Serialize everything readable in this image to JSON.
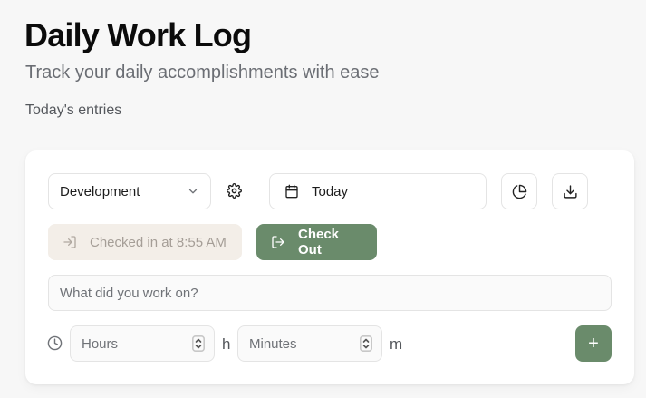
{
  "header": {
    "title": "Daily Work Log",
    "subtitle": "Track your daily accomplishments with ease",
    "section_label": "Today's entries"
  },
  "controls": {
    "category_value": "Development",
    "date_value": "Today"
  },
  "checkin": {
    "status_text": "Checked in at 8:55 AM",
    "checkout_label": "Check Out"
  },
  "entry": {
    "work_placeholder": "What did you work on?",
    "hours_placeholder": "Hours",
    "hours_unit": "h",
    "minutes_placeholder": "Minutes",
    "minutes_unit": "m",
    "add_label": "+"
  },
  "colors": {
    "accent": "#6a8b6b",
    "checked_in_bg": "#f3eee8"
  },
  "icons": {
    "dropdown": "chevron-down-icon",
    "settings": "gear-icon",
    "date": "calendar-icon",
    "chart": "pie-chart-icon",
    "download": "download-icon",
    "checked_in": "login-icon",
    "checkout": "logout-icon",
    "duration": "clock-icon",
    "spinner": "chevron-up-down-icon",
    "add": "plus-icon"
  }
}
